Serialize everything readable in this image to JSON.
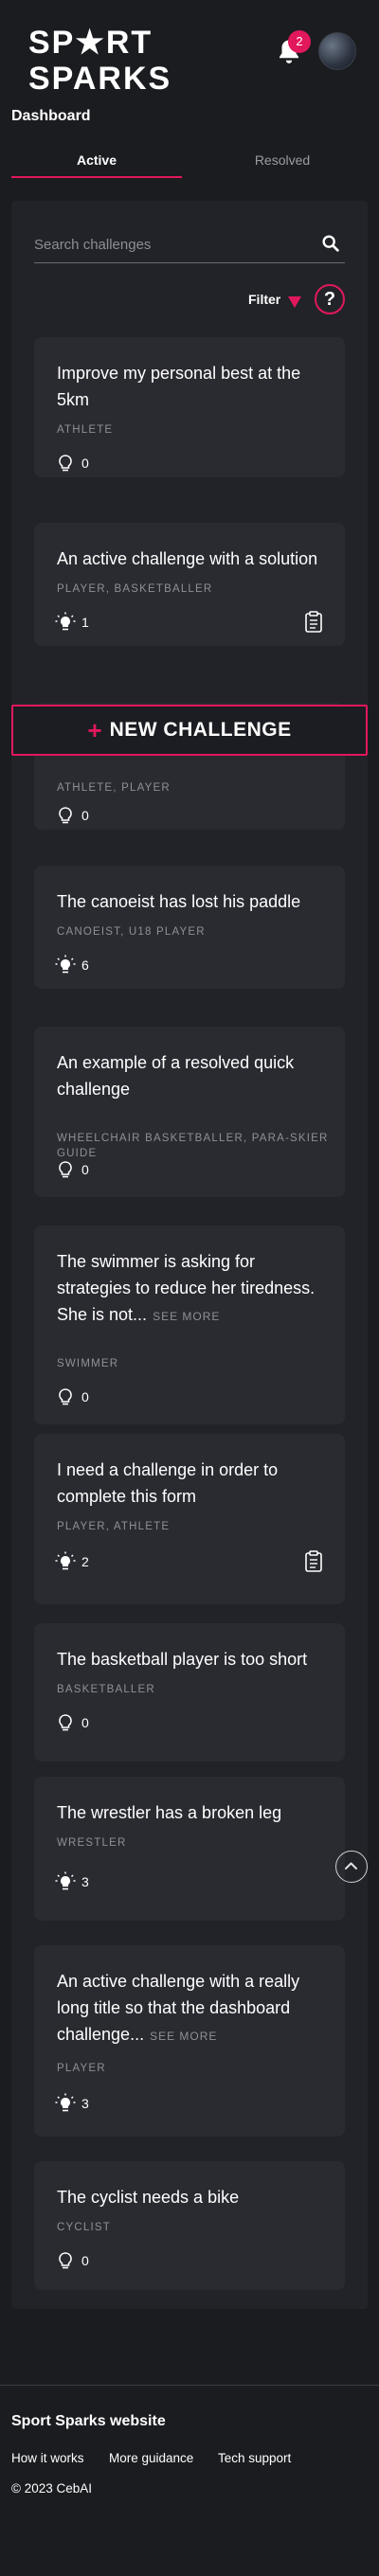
{
  "header": {
    "logo_line1": "SP★RT",
    "logo_line2": "SPARKS",
    "notifications_count": "2"
  },
  "page_title": "Dashboard",
  "tabs": {
    "active": "Active",
    "resolved": "Resolved"
  },
  "search": {
    "placeholder": "Search challenges"
  },
  "filter": {
    "label": "Filter"
  },
  "help": {
    "label": "?"
  },
  "new_challenge": {
    "plus": "+",
    "label": "NEW CHALLENGE"
  },
  "colors": {
    "accent": "#e2185c",
    "bg": "#1b1c20",
    "panel": "#222328",
    "card": "#2a2b31"
  },
  "cards": [
    {
      "title": "Improve my personal best at the 5km",
      "see_more": "",
      "tags": "ATHLETE",
      "solutions": "0",
      "lit": false,
      "clipboard": false
    },
    {
      "title": "An active challenge with a solution",
      "see_more": "",
      "tags": "PLAYER, BASKETBALLER",
      "solutions": "1",
      "lit": true,
      "clipboard": true
    },
    {
      "title": "",
      "see_more": "",
      "tags": "ATHLETE, PLAYER",
      "solutions": "0",
      "lit": false,
      "clipboard": false
    },
    {
      "title": "The canoeist has lost his paddle",
      "see_more": "",
      "tags": "CANOEIST, U18 PLAYER",
      "solutions": "6",
      "lit": true,
      "clipboard": false
    },
    {
      "title": "An example of a resolved quick challenge",
      "see_more": "",
      "tags": "WHEELCHAIR BASKETBALLER, PARA-SKIER GUIDE",
      "solutions": "0",
      "lit": false,
      "clipboard": false
    },
    {
      "title": "The swimmer is asking for strategies to reduce her tiredness. She is not...",
      "see_more": "SEE MORE",
      "tags": "SWIMMER",
      "solutions": "0",
      "lit": false,
      "clipboard": false
    },
    {
      "title": "I need a challenge in order to complete this form",
      "see_more": "",
      "tags": "PLAYER, ATHLETE",
      "solutions": "2",
      "lit": true,
      "clipboard": true
    },
    {
      "title": "The basketball player is too short",
      "see_more": "",
      "tags": "BASKETBALLER",
      "solutions": "0",
      "lit": false,
      "clipboard": false
    },
    {
      "title": "The wrestler has a broken leg",
      "see_more": "",
      "tags": "WRESTLER",
      "solutions": "3",
      "lit": true,
      "clipboard": false
    },
    {
      "title": "An active challenge with a really long title so that the dashboard challenge...",
      "see_more": "SEE MORE",
      "tags": "PLAYER",
      "solutions": "3",
      "lit": true,
      "clipboard": false
    },
    {
      "title": "The cyclist needs a bike",
      "see_more": "",
      "tags": "CYCLIST",
      "solutions": "0",
      "lit": false,
      "clipboard": false
    }
  ],
  "footer": {
    "title": "Sport Sparks website",
    "links": [
      "How it works",
      "More guidance",
      "Tech support"
    ],
    "copyright": "© 2023 CebAI"
  }
}
